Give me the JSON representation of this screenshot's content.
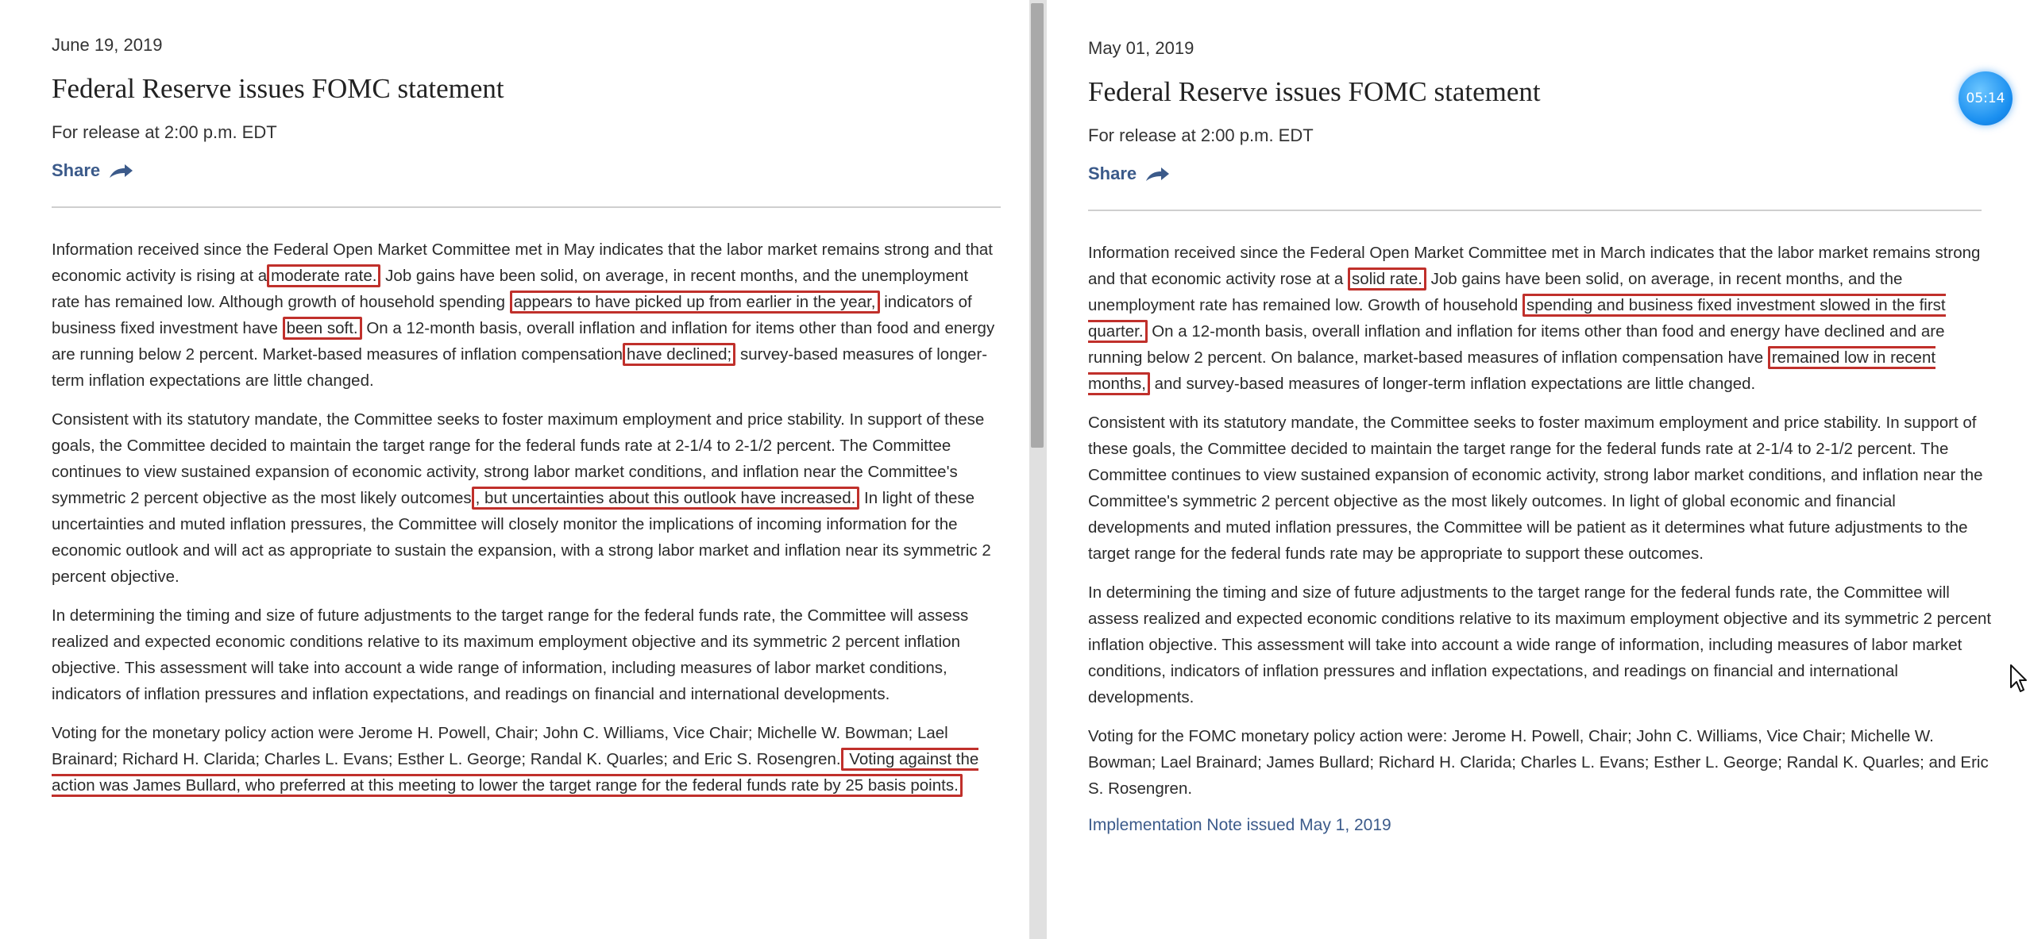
{
  "left": {
    "date": "June 19, 2019",
    "title": "Federal Reserve issues FOMC statement",
    "release": "For release at 2:00 p.m. EDT",
    "share_label": "Share",
    "p1": {
      "t1": "Information received since the Federal Open Market Committee met in May indicates that the labor market remains strong and that economic activity is rising at a",
      "h1": "moderate rate.",
      "t2": " Job gains have been solid, on average, in recent months, and the unemployment rate has remained low. Although growth of household spending",
      "h2": "appears to have picked up from earlier in the year,",
      "t3": " indicators of business fixed investment have",
      "h3": "been soft.",
      "t4": " On a 12-month basis, overall inflation and inflation for items other than food and energy are running below 2 percent. Market-based measures of inflation compensation",
      "h4": "have declined;",
      "t5": " survey-based measures of longer-term inflation expectations are little changed."
    },
    "p2": {
      "t1": "Consistent with its statutory mandate, the Committee seeks to foster maximum employment and price stability. In support of these goals, the Committee decided to maintain the target range for the federal funds rate at 2-1/4 to 2-1/2 percent. The Committee continues to view sustained expansion of economic activity, strong labor market conditions, and inflation near the Committee's symmetric 2 percent objective as the most likely outcomes",
      "h1": ", but uncertainties about this outlook have increased.",
      "t2": " In light of these uncertainties and muted inflation pressures, the Committee will closely monitor the implications of incoming information for the economic outlook and will act as appropriate to sustain the expansion, with a strong labor market and inflation near its symmetric 2 percent objective."
    },
    "p3": "In determining the timing and size of future adjustments to the target range for the federal funds rate, the Committee will assess realized and expected economic conditions relative to its maximum employment objective and its symmetric 2 percent inflation objective. This assessment will take into account a wide range of information, including measures of labor market conditions, indicators of inflation pressures and inflation expectations, and readings on financial and international developments.",
    "p4": {
      "t1": "Voting for the monetary policy action were Jerome H. Powell, Chair; John C. Williams, Vice Chair; Michelle W. Bowman; Lael Brainard; Richard H. Clarida; Charles L. Evans; Esther L. George; Randal K. Quarles; and Eric S. Rosengren.",
      "h1": " Voting against the action was James Bullard, who preferred at this meeting to lower the target range for the federal funds rate by 25 basis points."
    }
  },
  "right": {
    "date": "May 01, 2019",
    "title": "Federal Reserve issues FOMC statement",
    "release": "For release at 2:00 p.m. EDT",
    "share_label": "Share",
    "p1": {
      "t1": "Information received since the Federal Open Market Committee met in March indicates that the labor market remains strong and that economic activity rose at a",
      "h1": "solid rate.",
      "t2": " Job gains have been solid, on average, in recent months, and the unemployment rate has remained low. Growth of household",
      "h2": "spending and business fixed investment slowed in the first quarter.",
      "t3": " On a 12-month basis, overall inflation and inflation for items other than food and energy have declined and are running below 2 percent. On balance, market-based measures of inflation compensation have",
      "h3": "remained low in recent months,",
      "t4": " and survey-based measures of longer-term inflation expectations are little changed."
    },
    "p2": "Consistent with its statutory mandate, the Committee seeks to foster maximum employment and price stability. In support of these goals, the Committee decided to maintain the target range for the federal funds rate at 2-1/4 to 2-1/2 percent. The Committee continues to view sustained expansion of economic activity, strong labor market conditions, and inflation near the Committee's symmetric 2 percent objective as the most likely outcomes. In light of global economic and financial developments and muted inflation pressures, the Committee will be patient as it determines what future adjustments to the target range for the federal funds rate may be appropriate to support these outcomes.",
    "p3": "In determining the timing and size of future adjustments to the target range for the federal funds rate, the Committee will assess realized and expected economic conditions relative to its maximum employment objective and its symmetric 2 percent inflation objective. This assessment will take into account a wide range of information, including measures of labor market conditions, indicators of inflation pressures and inflation expectations, and readings on financial and international developments.",
    "p4": "Voting for the FOMC monetary policy action were: Jerome H. Powell, Chair; John C. Williams, Vice Chair; Michelle W. Bowman; Lael Brainard; James Bullard; Richard H. Clarida; Charles L. Evans; Esther L. George; Randal K. Quarles; and Eric S. Rosengren.",
    "note_link": "Implementation Note issued May 1, 2019"
  },
  "timer": "05:14",
  "colors": {
    "highlight_border": "#c0302b",
    "link": "#3b5a8a",
    "timer_badge": "#1a8ff0"
  },
  "icons": {
    "share": "share-arrow-icon",
    "cursor": "mouse-pointer-icon"
  }
}
